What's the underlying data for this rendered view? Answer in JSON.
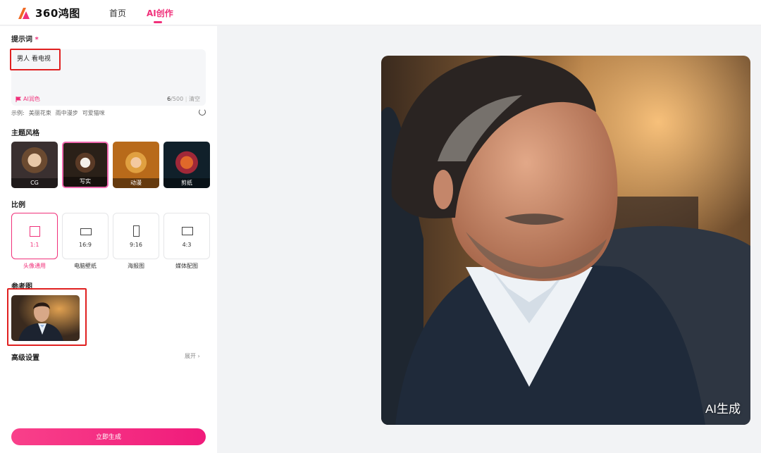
{
  "app": {
    "logo_text": "360鸿图"
  },
  "nav": {
    "home": "首页",
    "ai_create": "AI创作"
  },
  "prompt": {
    "title": "提示词",
    "required_mark": "*",
    "value": "男人 看电视",
    "ai_color_label": "AI润色",
    "count": "6",
    "max": "/500",
    "clear": "清空",
    "examples_label": "示例:",
    "examples": [
      "美丽花束",
      "雨中漫步",
      "可爱猫咪"
    ]
  },
  "styles": {
    "title": "主题风格",
    "items": [
      {
        "label": "CG"
      },
      {
        "label": "写实"
      },
      {
        "label": "动漫"
      },
      {
        "label": "剪纸"
      }
    ]
  },
  "ratio": {
    "title": "比例",
    "items": [
      {
        "value": "1:1",
        "desc": "头像通用"
      },
      {
        "value": "16:9",
        "desc": "电脑壁纸"
      },
      {
        "value": "9:16",
        "desc": "海报图"
      },
      {
        "value": "4:3",
        "desc": "媒体配图"
      }
    ]
  },
  "reference": {
    "title": "参考图"
  },
  "advanced": {
    "title": "高级设置",
    "expand": "展开 ›"
  },
  "generate_button": "立即生成",
  "result": {
    "watermark": "AI生成"
  },
  "colors": {
    "accent": "#f0307a",
    "highlight_box": "#e02020"
  }
}
